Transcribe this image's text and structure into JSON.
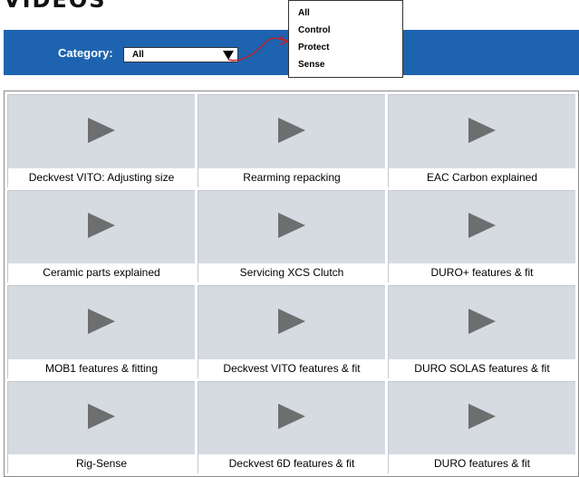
{
  "header": {
    "title": "VIDEOS"
  },
  "filter": {
    "label": "Category:",
    "selected": "All",
    "options": [
      "All",
      "Control",
      "Protect",
      "Sense"
    ]
  },
  "videos": [
    {
      "title": "Deckvest VITO: Adjusting size"
    },
    {
      "title": "Rearming repacking"
    },
    {
      "title": "EAC Carbon explained"
    },
    {
      "title": "Ceramic parts explained"
    },
    {
      "title": "Servicing XCS Clutch"
    },
    {
      "title": "DURO+ features & fit"
    },
    {
      "title": "MOB1 features & fitting"
    },
    {
      "title": "Deckvest VITO features & fit"
    },
    {
      "title": "DURO SOLAS features & fit"
    },
    {
      "title": "Rig-Sense"
    },
    {
      "title": "Deckvest 6D features & fit"
    },
    {
      "title": "DURO features & fit"
    }
  ],
  "colors": {
    "filter_bar": "#1e63b0",
    "tile_bg": "#d6dbe2",
    "play_icon": "#6d6e70",
    "annotation_arrow": "#c0202a"
  }
}
